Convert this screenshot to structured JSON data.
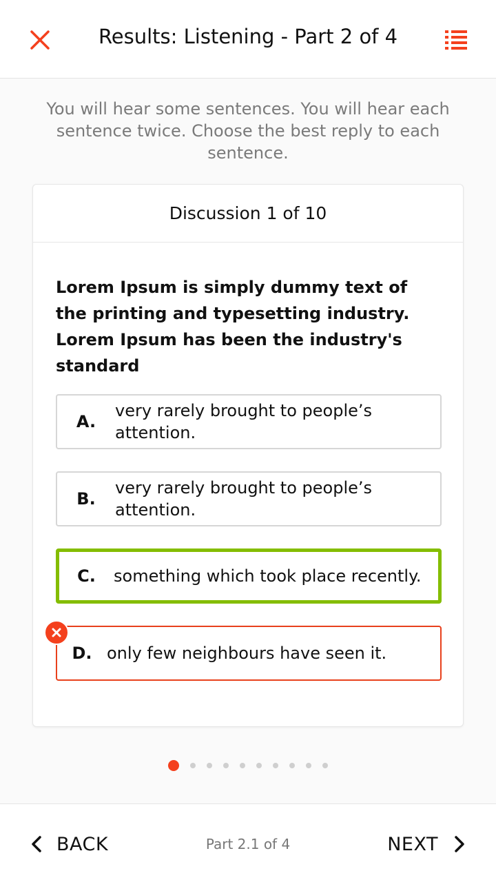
{
  "header": {
    "title": "Results: Listening - Part 2 of 4",
    "close_icon": "close-icon",
    "list_icon": "list-icon",
    "accent_color": "#f4401d"
  },
  "instructions": "You will hear some sentences. You will hear each sentence twice. Choose the best reply to each sentence.",
  "card": {
    "heading": "Discussion 1 of 10",
    "question": "Lorem Ipsum is simply dummy text of the printing and typesetting industry. Lorem Ipsum has been the industry's standard",
    "options": [
      {
        "letter": "A.",
        "text": "very rarely brought to people’s attention.",
        "state": "neutral"
      },
      {
        "letter": "B.",
        "text": "very rarely brought to people’s attention.",
        "state": "neutral"
      },
      {
        "letter": "C.",
        "text": "something which took place recently.",
        "state": "correct"
      },
      {
        "letter": "D.",
        "text": "only few neighbours have seen it.",
        "state": "wrong"
      }
    ],
    "correct_color": "#84bd00",
    "wrong_color": "#e8401c"
  },
  "pagination": {
    "total": 10,
    "current": 1
  },
  "footer": {
    "back_label": "BACK",
    "part_label": "Part 2.1 of 4",
    "next_label": "NEXT"
  }
}
